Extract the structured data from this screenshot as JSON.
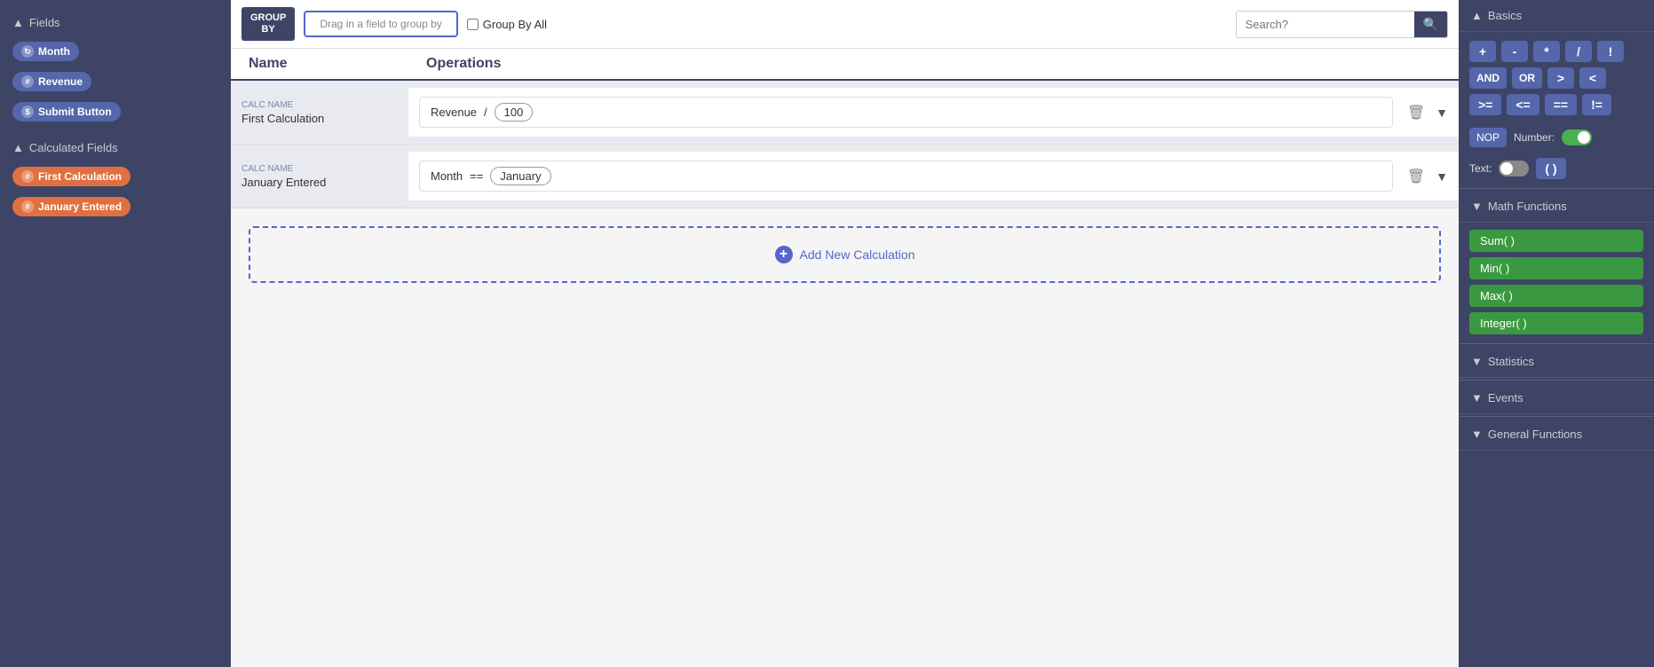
{
  "sidebar": {
    "fields_section": {
      "label": "Fields",
      "chevron": "▲"
    },
    "fields": [
      {
        "id": "month",
        "label": "Month",
        "icon": "↻",
        "type": "blue"
      },
      {
        "id": "revenue",
        "label": "Revenue",
        "icon": "#",
        "type": "blue"
      },
      {
        "id": "submit-button",
        "label": "Submit Button",
        "icon": "$",
        "type": "blue"
      }
    ],
    "calculated_section": {
      "label": "Calculated Fields",
      "chevron": "▲"
    },
    "calculated_fields": [
      {
        "id": "first-calculation",
        "label": "First Calculation",
        "icon": "#",
        "type": "orange"
      },
      {
        "id": "january-entered",
        "label": "January Entered",
        "icon": "#",
        "type": "orange"
      }
    ]
  },
  "header": {
    "group_by_label": "GROUP\nBY",
    "drag_placeholder": "Drag in a field to group by",
    "group_by_all_label": "Group By All",
    "search_placeholder": "Search?"
  },
  "columns": {
    "name": "Name",
    "operations": "Operations"
  },
  "calculations": [
    {
      "id": "first-calculation",
      "calc_label": "Calc Name",
      "name": "First Calculation",
      "expression": [
        {
          "text": "Revenue",
          "boxed": false
        },
        {
          "text": "/",
          "boxed": false
        },
        {
          "text": "100",
          "boxed": true
        }
      ]
    },
    {
      "id": "january-entered",
      "calc_label": "Calc Name",
      "name": "January Entered",
      "expression": [
        {
          "text": "Month",
          "boxed": false
        },
        {
          "text": "==",
          "boxed": false
        },
        {
          "text": "January",
          "boxed": true
        }
      ]
    }
  ],
  "add_calc": {
    "label": "Add New Calculation",
    "plus": "+"
  },
  "right_panel": {
    "basics": {
      "label": "Basics",
      "chevron": "▲",
      "operators": [
        "+",
        "-",
        "*",
        "/",
        "!",
        "AND",
        "OR",
        ">",
        "<",
        ">=",
        "<=",
        "==",
        "!="
      ],
      "nop_label": "NOP",
      "number_label": "Number:",
      "text_label": "Text:",
      "paren_label": "( )"
    },
    "math": {
      "label": "Math Functions",
      "chevron": "▼",
      "functions": [
        "Sum( )",
        "Min( )",
        "Max( )",
        "Integer( )"
      ]
    },
    "statistics": {
      "label": "Statistics",
      "chevron": "▼"
    },
    "events": {
      "label": "Events",
      "chevron": "▼"
    },
    "general": {
      "label": "General Functions",
      "chevron": "▼"
    }
  }
}
